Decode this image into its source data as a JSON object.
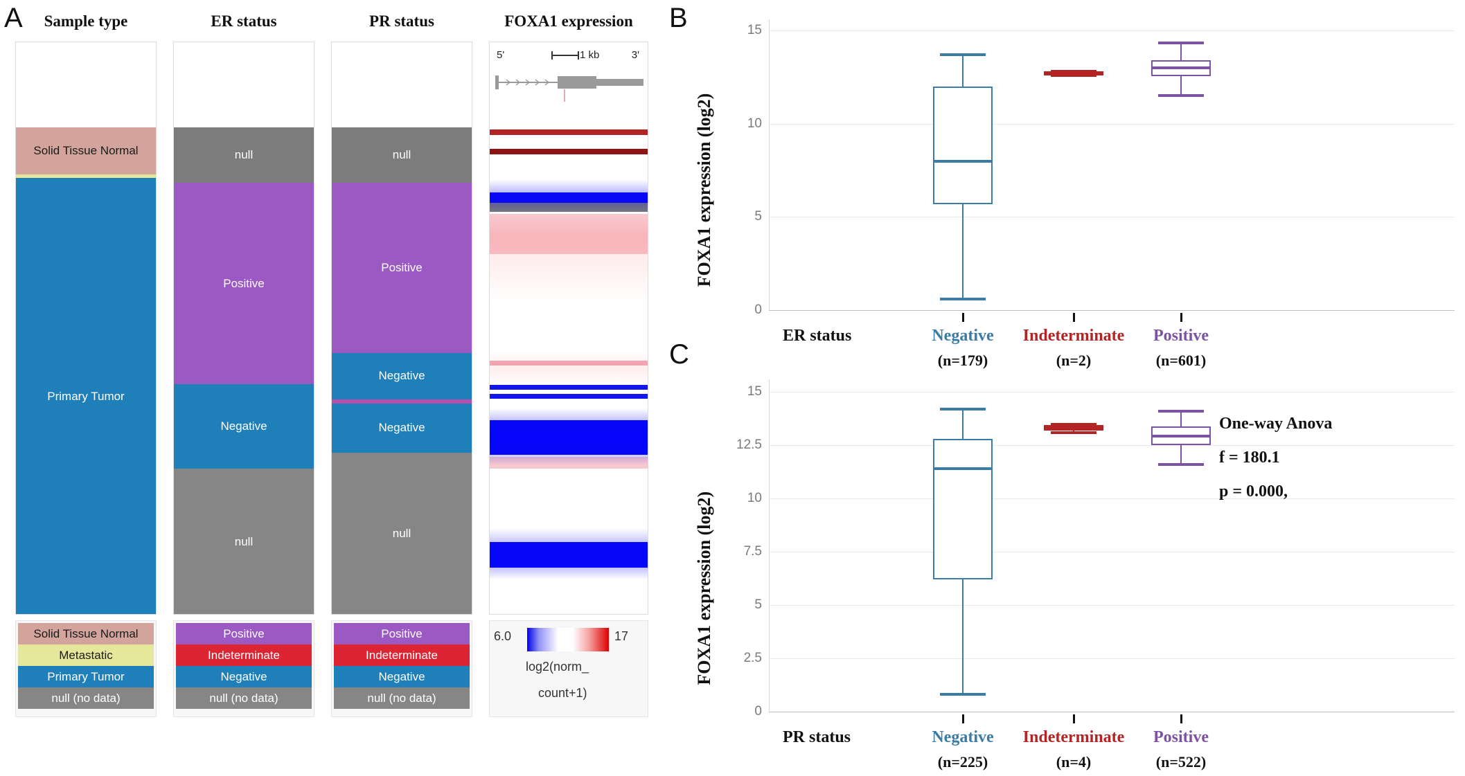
{
  "panels": {
    "a_letter": "A",
    "b_letter": "B",
    "c_letter": "C"
  },
  "panel_a": {
    "columns": [
      {
        "header": "Sample type",
        "segments": [
          {
            "label": "",
            "color": "#ffffff",
            "text_color": "#ffffff",
            "frac": 0.148
          },
          {
            "label": "Solid Tissue Normal",
            "color": "#d3a49b",
            "text_color": "#1a1a1a",
            "frac": 0.083
          },
          {
            "label": "",
            "color": "#e5e79a",
            "text_color": "#1a1a1a",
            "frac": 0.006
          },
          {
            "label": "Primary Tumor",
            "color": "#1f7fb8",
            "text_color": "#ffffff",
            "frac": 0.763
          }
        ],
        "legend": [
          {
            "label": "Solid Tissue Normal",
            "color": "#d3a49b",
            "text_color": "#1a1a1a"
          },
          {
            "label": "Metastatic",
            "color": "#e5e79a",
            "text_color": "#1a1a1a"
          },
          {
            "label": "Primary Tumor",
            "color": "#1f7fb8",
            "text_color": "#ffffff"
          },
          {
            "label": "null (no data)",
            "color": "#868686",
            "text_color": "#ffffff"
          }
        ]
      },
      {
        "header": "ER status",
        "segments": [
          {
            "label": "",
            "color": "#ffffff",
            "text_color": "#ffffff",
            "frac": 0.148
          },
          {
            "label": "null",
            "color": "#7c7c7c",
            "text_color": "#ffffff",
            "frac": 0.097
          },
          {
            "label": "Positive",
            "color": "#9b59c4",
            "text_color": "#ffffff",
            "frac": 0.352
          },
          {
            "label": "Negative",
            "color": "#1f7fb8",
            "text_color": "#ffffff",
            "frac": 0.147
          },
          {
            "label": "null",
            "color": "#868686",
            "text_color": "#ffffff",
            "frac": 0.256
          }
        ],
        "legend": [
          {
            "label": "Positive",
            "color": "#9b59c4",
            "text_color": "#ffffff"
          },
          {
            "label": "Indeterminate",
            "color": "#dc2433",
            "text_color": "#ffffff"
          },
          {
            "label": "Negative",
            "color": "#1f7fb8",
            "text_color": "#ffffff"
          },
          {
            "label": "null (no data)",
            "color": "#868686",
            "text_color": "#ffffff"
          }
        ]
      },
      {
        "header": "PR status",
        "segments": [
          {
            "label": "",
            "color": "#ffffff",
            "text_color": "#ffffff",
            "frac": 0.148
          },
          {
            "label": "null",
            "color": "#7c7c7c",
            "text_color": "#ffffff",
            "frac": 0.097
          },
          {
            "label": "Positive",
            "color": "#9b59c4",
            "text_color": "#ffffff",
            "frac": 0.297
          },
          {
            "label": "Negative",
            "color": "#1f7fb8",
            "text_color": "#ffffff",
            "frac": 0.081
          },
          {
            "label": "",
            "color": "#b44fae",
            "text_color": "#ffffff",
            "frac": 0.007
          },
          {
            "label": "Negative",
            "color": "#1f7fb8",
            "text_color": "#ffffff",
            "frac": 0.086
          },
          {
            "label": "null",
            "color": "#868686",
            "text_color": "#ffffff",
            "frac": 0.284
          }
        ],
        "legend": [
          {
            "label": "Positive",
            "color": "#9b59c4",
            "text_color": "#ffffff"
          },
          {
            "label": "Indeterminate",
            "color": "#dc2433",
            "text_color": "#ffffff"
          },
          {
            "label": "Negative",
            "color": "#1f7fb8",
            "text_color": "#ffffff"
          },
          {
            "label": "null (no data)",
            "color": "#868686",
            "text_color": "#ffffff"
          }
        ]
      }
    ],
    "heatmap": {
      "header": "FOXA1 expression",
      "strand_left": "5'",
      "strand_right": "3'",
      "scale_label": "1 kb",
      "colorbar": {
        "min": "6.0",
        "max": "17",
        "caption_line1": "log2(norm_",
        "caption_line2": "count+1)",
        "low_color": "#0000ee",
        "mid_color": "#ffffff",
        "high_color": "#dd0000"
      },
      "bands": [
        {
          "top": 0.152,
          "height": 0.01,
          "color": "#b42424"
        },
        {
          "top": 0.186,
          "height": 0.01,
          "color": "#8d1414"
        },
        {
          "top": 0.162,
          "height": 0.024,
          "color": "#ffffff"
        },
        {
          "top": 0.262,
          "height": 0.018,
          "color": "#0c0cf0"
        },
        {
          "top": 0.28,
          "height": 0.016,
          "color": "#7a7a7a"
        },
        {
          "top": 0.3,
          "height": 0.07,
          "color": "#f7c9cf"
        },
        {
          "top": 0.556,
          "height": 0.008,
          "color": "#f0aebb"
        },
        {
          "top": 0.598,
          "height": 0.008,
          "color": "#1414ee"
        },
        {
          "top": 0.614,
          "height": 0.008,
          "color": "#1414ee"
        },
        {
          "top": 0.66,
          "height": 0.06,
          "color": "#0a0af5"
        },
        {
          "top": 0.724,
          "height": 0.02,
          "color": "#f7c9cf"
        },
        {
          "top": 0.872,
          "height": 0.045,
          "color": "#0a0af5"
        }
      ]
    }
  },
  "chart_data": [
    {
      "type": "box",
      "panel": "B",
      "ylabel": "FOXA1 expression (log2)",
      "xlabel": "ER status",
      "yticks": [
        "0",
        "5",
        "10",
        "15"
      ],
      "ylim": [
        0,
        15.6
      ],
      "grid": true,
      "categories": [
        {
          "name": "Negative",
          "n": "(n=179)",
          "color": "#3a7ca5"
        },
        {
          "name": "Indeterminate",
          "n": "(n=2)",
          "color": "#b32525"
        },
        {
          "name": "Positive",
          "n": "(n=601)",
          "color": "#7b52a6"
        }
      ],
      "boxes": [
        {
          "whisker_low": 0.6,
          "q1": 5.7,
          "median": 8.0,
          "q3": 12.0,
          "whisker_high": 13.7
        },
        {
          "whisker_low": 12.6,
          "q1": 12.62,
          "median": 12.7,
          "q3": 12.8,
          "whisker_high": 12.82
        },
        {
          "whisker_low": 11.5,
          "q1": 12.55,
          "median": 13.0,
          "q3": 13.4,
          "whisker_high": 14.35
        }
      ]
    },
    {
      "type": "box",
      "panel": "C",
      "ylabel": "FOXA1 expression (log2)",
      "xlabel": "PR status",
      "yticks": [
        "0",
        "2.5",
        "5",
        "7.5",
        "10",
        "12.5",
        "15"
      ],
      "ylim": [
        0,
        15.6
      ],
      "grid": true,
      "categories": [
        {
          "name": "Negative",
          "n": "(n=225)",
          "color": "#3a7ca5"
        },
        {
          "name": "Indeterminate",
          "n": "(n=4)",
          "color": "#b32525"
        },
        {
          "name": "Positive",
          "n": "(n=522)",
          "color": "#7b52a6"
        }
      ],
      "boxes": [
        {
          "whisker_low": 0.8,
          "q1": 6.2,
          "median": 11.4,
          "q3": 12.8,
          "whisker_high": 14.2
        },
        {
          "whisker_low": 13.1,
          "q1": 13.2,
          "median": 13.33,
          "q3": 13.45,
          "whisker_high": 13.5
        },
        {
          "whisker_low": 11.6,
          "q1": 12.5,
          "median": 12.95,
          "q3": 13.4,
          "whisker_high": 14.1
        }
      ],
      "annotation": {
        "line1": "One-way Anova",
        "line2": "f = 180.1",
        "line3": "p = 0.000,"
      }
    }
  ]
}
